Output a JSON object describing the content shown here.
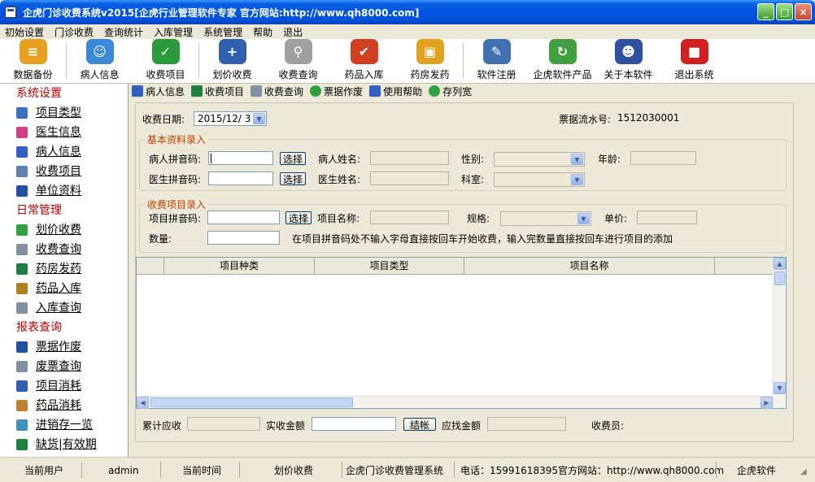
{
  "window": {
    "title": "企虎门诊收费系统v2015[企虎行业管理软件专家 官方网站:http://www.qh8000.com]",
    "min_glyph": "_",
    "max_glyph": "□",
    "close_glyph": "×"
  },
  "menu": [
    "初始设置",
    "门诊收费",
    "查询统计",
    "入库管理",
    "系统管理",
    "帮助",
    "退出"
  ],
  "toolbar": [
    {
      "label": "数据备份",
      "icon": "database-icon",
      "color": "#e8a020"
    },
    {
      "label": "病人信息",
      "icon": "chat-bubble-icon",
      "color": "#3a8ad8"
    },
    {
      "label": "收费项目",
      "icon": "checklist-icon",
      "color": "#2a9a3a"
    },
    {
      "label": "划价收费",
      "icon": "database-add-icon",
      "color": "#3060b0"
    },
    {
      "label": "收费查询",
      "icon": "magnifier-icon",
      "color": "#a0a0a0"
    },
    {
      "label": "药品入库",
      "icon": "checkmark-icon",
      "color": "#d04020"
    },
    {
      "label": "药房发药",
      "icon": "box-icon",
      "color": "#e0a020"
    },
    {
      "label": "软件注册",
      "icon": "pen-icon",
      "color": "#4070b0"
    },
    {
      "label": "企虎软件产品",
      "icon": "refresh-icon",
      "color": "#40a040"
    },
    {
      "label": "关于本软件",
      "icon": "mascot-icon",
      "color": "#3050a0"
    },
    {
      "label": "退出系统",
      "icon": "exit-cube-icon",
      "color": "#d02020"
    }
  ],
  "nav": [
    {
      "type": "group",
      "label": "系统设置"
    },
    {
      "type": "item",
      "label": "项目类型",
      "icon": "pen-icon",
      "color": "#3a70c0"
    },
    {
      "type": "item",
      "label": "医生信息",
      "icon": "doctor-icon",
      "color": "#d04080"
    },
    {
      "type": "item",
      "label": "病人信息",
      "icon": "patient-icon",
      "color": "#3060c0"
    },
    {
      "type": "item",
      "label": "收费项目",
      "icon": "disc-icon",
      "color": "#6080b0"
    },
    {
      "type": "item",
      "label": "单位资料",
      "icon": "arrow-doc-icon",
      "color": "#2050a0"
    },
    {
      "type": "group",
      "label": "日常管理"
    },
    {
      "type": "item",
      "label": "划价收费",
      "icon": "checklist-icon",
      "color": "#30a040"
    },
    {
      "type": "item",
      "label": "收费查询",
      "icon": "magnifier-icon",
      "color": "#8090a0"
    },
    {
      "type": "item",
      "label": "药房发药",
      "icon": "book-icon",
      "color": "#208040"
    },
    {
      "type": "item",
      "label": "药品入库",
      "icon": "key-icon",
      "color": "#b08020"
    },
    {
      "type": "item",
      "label": "入库查询",
      "icon": "magnifier-icon",
      "color": "#8090a0"
    },
    {
      "type": "group",
      "label": "报表查询"
    },
    {
      "type": "item",
      "label": "票据作废",
      "icon": "arrow-doc-icon",
      "color": "#2050a0"
    },
    {
      "type": "item",
      "label": "废票查询",
      "icon": "magnifier-icon",
      "color": "#8090a0"
    },
    {
      "type": "item",
      "label": "项目消耗",
      "icon": "list-icon",
      "color": "#3060b0"
    },
    {
      "type": "item",
      "label": "药品消耗",
      "icon": "box-icon",
      "color": "#c08030"
    },
    {
      "type": "item",
      "label": "进销存一览",
      "icon": "people-icon",
      "color": "#4090c0"
    },
    {
      "type": "item",
      "label": "缺货|有效期",
      "icon": "book-icon",
      "color": "#208040"
    }
  ],
  "subbar": [
    {
      "label": "病人信息",
      "icon": "patient-icon",
      "color": "#3060c0"
    },
    {
      "label": "收费项目",
      "icon": "checklist-icon",
      "color": "#208040"
    },
    {
      "label": "收费查询",
      "icon": "magnifier-icon",
      "color": "#8090a0"
    },
    {
      "label": "票据作废",
      "icon": "go-icon",
      "color": "#30a040"
    },
    {
      "label": "使用帮助",
      "icon": "sort-icon",
      "color": "#3060c0"
    },
    {
      "label": "存列宽",
      "icon": "go-icon",
      "color": "#30a040"
    }
  ],
  "form": {
    "date_label": "收费日期:",
    "date_value": "2015/12/ 3",
    "serial_label": "票据流水号:",
    "serial_value": "1512030001",
    "basic_legend": "基本资料录入",
    "patient_code_label": "病人拼音码:",
    "select_label": "选择",
    "patient_name_label": "病人姓名:",
    "gender_label": "性别:",
    "age_label": "年龄:",
    "doctor_code_label": "医生拼音码:",
    "doctor_name_label": "医生姓名:",
    "dept_label": "科室:",
    "items_legend": "收费项目录入",
    "item_code_label": "项目拼音码:",
    "item_name_label": "项目名称:",
    "spec_label": "规格:",
    "price_label": "单价:",
    "qty_label": "数量:",
    "hint": "在项目拼音码处不输入字母直接按回车开始收费，输入完数量直接按回车进行项目的添加",
    "total_label": "累计应收",
    "paid_label": "实收金额",
    "checkout_label": "结帐",
    "change_label": "应找金额",
    "cashier_label": "收费员:"
  },
  "grid": {
    "columns": [
      "",
      "项目种类",
      "项目类型",
      "项目名称"
    ]
  },
  "status": {
    "user_label": "当前用户",
    "user": "admin",
    "time_label": "当前时间",
    "module": "划价收费",
    "system": "企虎门诊收费管理系统",
    "phone": "电话：15991618395",
    "site": "官方网站：http://www.qh8000.com",
    "brand": "企虎软件"
  }
}
